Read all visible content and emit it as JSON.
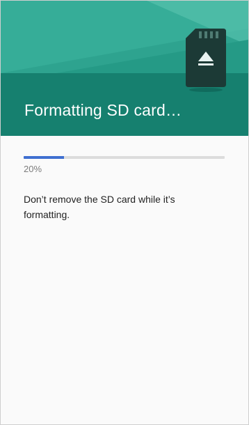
{
  "header": {
    "title": "Formatting SD card…",
    "background_color": "#16806f",
    "icon": "sd-card-eject-icon"
  },
  "progress": {
    "fraction": 0.2,
    "percent_label": "20%",
    "fill_color": "#3f6fd0",
    "track_color": "#dcdcdc"
  },
  "message": "Don’t remove the SD card while it’s formatting."
}
